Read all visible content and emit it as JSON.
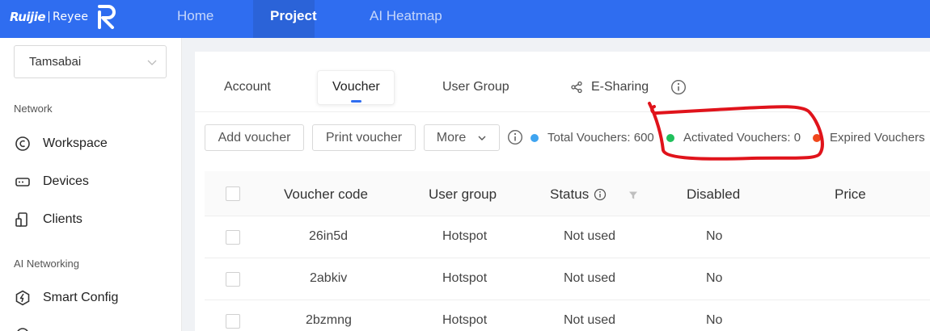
{
  "brand": {
    "name": "Ruijie",
    "product": "Reyee"
  },
  "top_nav": [
    {
      "label": "Home"
    },
    {
      "label": "Project"
    },
    {
      "label": "AI Heatmap"
    }
  ],
  "sidebar": {
    "project_select": {
      "value": "Tamsabai"
    },
    "sections": [
      {
        "title": "Network",
        "items": [
          {
            "label": "Workspace",
            "icon": "workspace-icon"
          },
          {
            "label": "Devices",
            "icon": "devices-icon"
          },
          {
            "label": "Clients",
            "icon": "clients-icon"
          }
        ]
      },
      {
        "title": "AI Networking",
        "items": [
          {
            "label": "Smart Config",
            "icon": "smart-config-icon"
          }
        ]
      }
    ]
  },
  "tabs": [
    {
      "label": "Account"
    },
    {
      "label": "Voucher"
    },
    {
      "label": "User Group"
    },
    {
      "label": "E-Sharing"
    }
  ],
  "toolbar": {
    "add_voucher": "Add voucher",
    "print_voucher": "Print voucher",
    "more": "More"
  },
  "stats": {
    "total": "Total Vouchers: 600",
    "activated": "Activated Vouchers: 0",
    "expired": "Expired Vouchers"
  },
  "colors": {
    "primary": "#2f6df0",
    "total_dot": "#3fa4f0",
    "activated_dot": "#20c05c",
    "expired_dot": "#f0471c",
    "annotation": "#e0131b"
  },
  "table": {
    "columns": [
      "Voucher code",
      "User group",
      "Status",
      "Disabled",
      "Price"
    ],
    "rows": [
      {
        "code": "26in5d",
        "group": "Hotspot",
        "status": "Not used",
        "disabled": "No",
        "price": ""
      },
      {
        "code": "2abkiv",
        "group": "Hotspot",
        "status": "Not used",
        "disabled": "No",
        "price": ""
      },
      {
        "code": "2bzmng",
        "group": "Hotspot",
        "status": "Not used",
        "disabled": "No",
        "price": ""
      }
    ]
  }
}
